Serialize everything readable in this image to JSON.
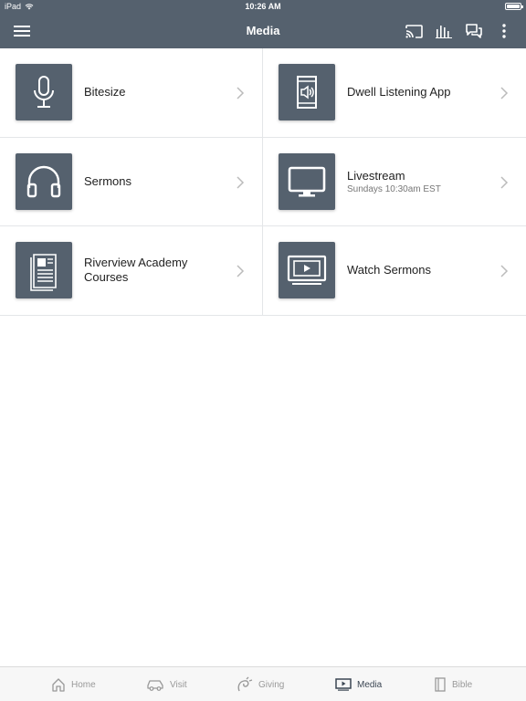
{
  "status_bar": {
    "device": "iPad",
    "time": "10:26 AM",
    "wifi_icon": "wifi-icon",
    "battery_icon": "battery-icon"
  },
  "nav": {
    "title": "Media",
    "buttons": [
      "menu-icon",
      "cast-icon",
      "equalizer-icon",
      "chat-icon",
      "more-vertical-icon"
    ]
  },
  "items": [
    {
      "title": "Bitesize",
      "subtitle": "",
      "icon": "microphone-icon"
    },
    {
      "title": "Dwell Listening App",
      "subtitle": "",
      "icon": "audio-book-icon"
    },
    {
      "title": "Sermons",
      "subtitle": "",
      "icon": "headphones-icon"
    },
    {
      "title": "Livestream",
      "subtitle": "Sundays 10:30am EST",
      "icon": "monitor-icon"
    },
    {
      "title": "Riverview Academy Courses",
      "subtitle": "",
      "icon": "newspaper-icon"
    },
    {
      "title": "Watch Sermons",
      "subtitle": "",
      "icon": "video-play-icon"
    }
  ],
  "tabs": [
    {
      "label": "Home",
      "icon": "home-icon",
      "active": false
    },
    {
      "label": "Visit",
      "icon": "car-icon",
      "active": false
    },
    {
      "label": "Giving",
      "icon": "giving-icon",
      "active": false
    },
    {
      "label": "Media",
      "icon": "media-icon",
      "active": true
    },
    {
      "label": "Bible",
      "icon": "bible-icon",
      "active": false
    }
  ],
  "colors": {
    "header": "#55616e",
    "tile": "#55616e",
    "active_tab": "#3b4653",
    "inactive_tab": "#999999"
  }
}
